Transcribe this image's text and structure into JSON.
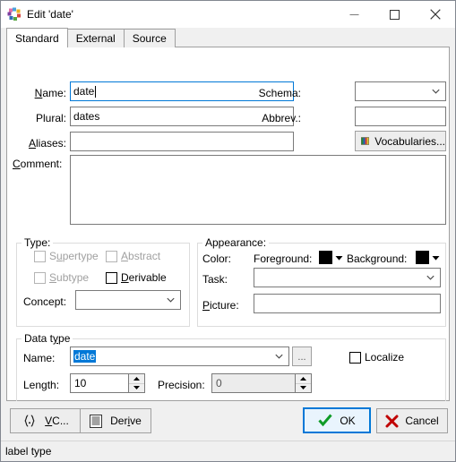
{
  "window": {
    "title": "Edit 'date'",
    "icon": "palette-flower-icon",
    "controls": {
      "minimize": "minimize-icon",
      "maximize": "maximize-icon",
      "close": "close-icon"
    }
  },
  "tabs": [
    {
      "label": "Standard",
      "selected": true
    },
    {
      "label": "External",
      "selected": false
    },
    {
      "label": "Source",
      "selected": false
    }
  ],
  "form": {
    "name_label": "Name:",
    "name_value": "date",
    "plural_label": "Plural:",
    "plural_value": "dates",
    "aliases_label": "Aliases:",
    "aliases_value": "",
    "comment_label": "Comment:",
    "comment_value": "",
    "schema_label": "Schema:",
    "schema_value": "",
    "abbrev_label": "Abbrev.:",
    "abbrev_value": "",
    "vocabularies_button": "Vocabularies..."
  },
  "type_group": {
    "title": "Type:",
    "supertype_label": "Supertype",
    "supertype_checked": false,
    "supertype_enabled": false,
    "abstract_label": "Abstract",
    "abstract_checked": false,
    "abstract_enabled": false,
    "subtype_label": "Subtype",
    "subtype_checked": false,
    "subtype_enabled": false,
    "derivable_label": "Derivable",
    "derivable_checked": false,
    "derivable_enabled": true,
    "concept_label": "Concept:",
    "concept_value": ""
  },
  "appearance_group": {
    "title": "Appearance:",
    "color_label": "Color:",
    "foreground_label": "Foreground:",
    "foreground_color": "#000000",
    "background_label": "Background:",
    "background_color": "#000000",
    "task_label": "Task:",
    "task_value": "",
    "picture_label": "Picture:",
    "picture_value": ""
  },
  "datatype_group": {
    "title": "Data type",
    "name_label": "Name:",
    "name_value": "date",
    "name_selected": true,
    "browse_button": "...",
    "localize_label": "Localize",
    "localize_checked": false,
    "length_label": "Length:",
    "length_value": "10",
    "precision_label": "Precision:",
    "precision_value": "0",
    "precision_enabled": false
  },
  "footer": {
    "vc_button": "VC...",
    "vc_icon": "braces-icon",
    "derive_button": "Derive",
    "derive_icon": "list-document-icon",
    "ok_button": "OK",
    "ok_icon": "green-check-icon",
    "cancel_button": "Cancel",
    "cancel_icon": "red-x-icon"
  },
  "statusbar": {
    "text": "label type"
  },
  "colors": {
    "accent": "#0078d7",
    "window_bg": "#f0f0f0",
    "field_bg": "#ffffff",
    "disabled_text": "#a0a0a0"
  }
}
